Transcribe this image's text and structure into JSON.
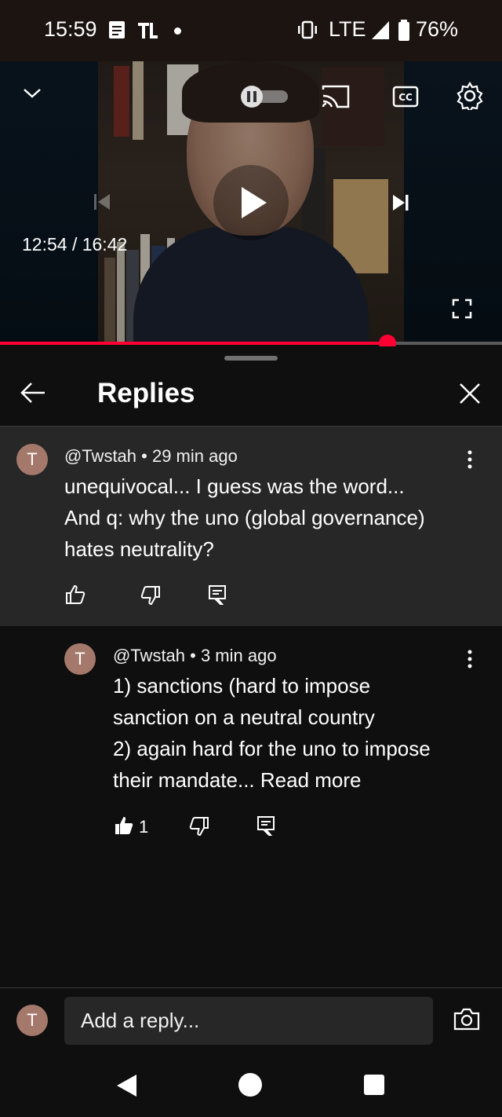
{
  "status_bar": {
    "time": "15:59",
    "network": "LTE",
    "battery": "76%",
    "icons": [
      "notes-icon",
      "news-icon",
      "dot-icon",
      "vibrate-icon",
      "signal-icon",
      "battery-icon"
    ]
  },
  "player": {
    "timecode": "12:54 / 16:42",
    "progress": 0.772,
    "accent": "#ff0033",
    "icons": [
      "chevron-down-icon",
      "pause-toggle-icon",
      "cast-icon",
      "cc-icon",
      "settings-icon",
      "previous-icon",
      "play-icon",
      "next-icon",
      "fullscreen-icon"
    ]
  },
  "panel": {
    "title": "Replies"
  },
  "comments": [
    {
      "avatar": "T",
      "author": "@Twstah • 29 min ago",
      "text_lines": [
        "unequivocal... I guess was the word...",
        "And q: why the uno (global governance)",
        "hates neutrality?"
      ],
      "likes": ""
    },
    {
      "avatar": "T",
      "author": "@Twstah • 3 min ago",
      "text_lines": [
        "1) sanctions (hard to impose",
        "sanction on a neutral country",
        "2) again hard for the uno to impose",
        "their mandate... "
      ],
      "more_label": "Read more",
      "likes": "1"
    }
  ],
  "reply_bar": {
    "avatar": "T",
    "placeholder": "Add a reply..."
  },
  "nav": {
    "icons": [
      "back-nav-icon",
      "home-nav-icon",
      "recents-nav-icon"
    ]
  }
}
